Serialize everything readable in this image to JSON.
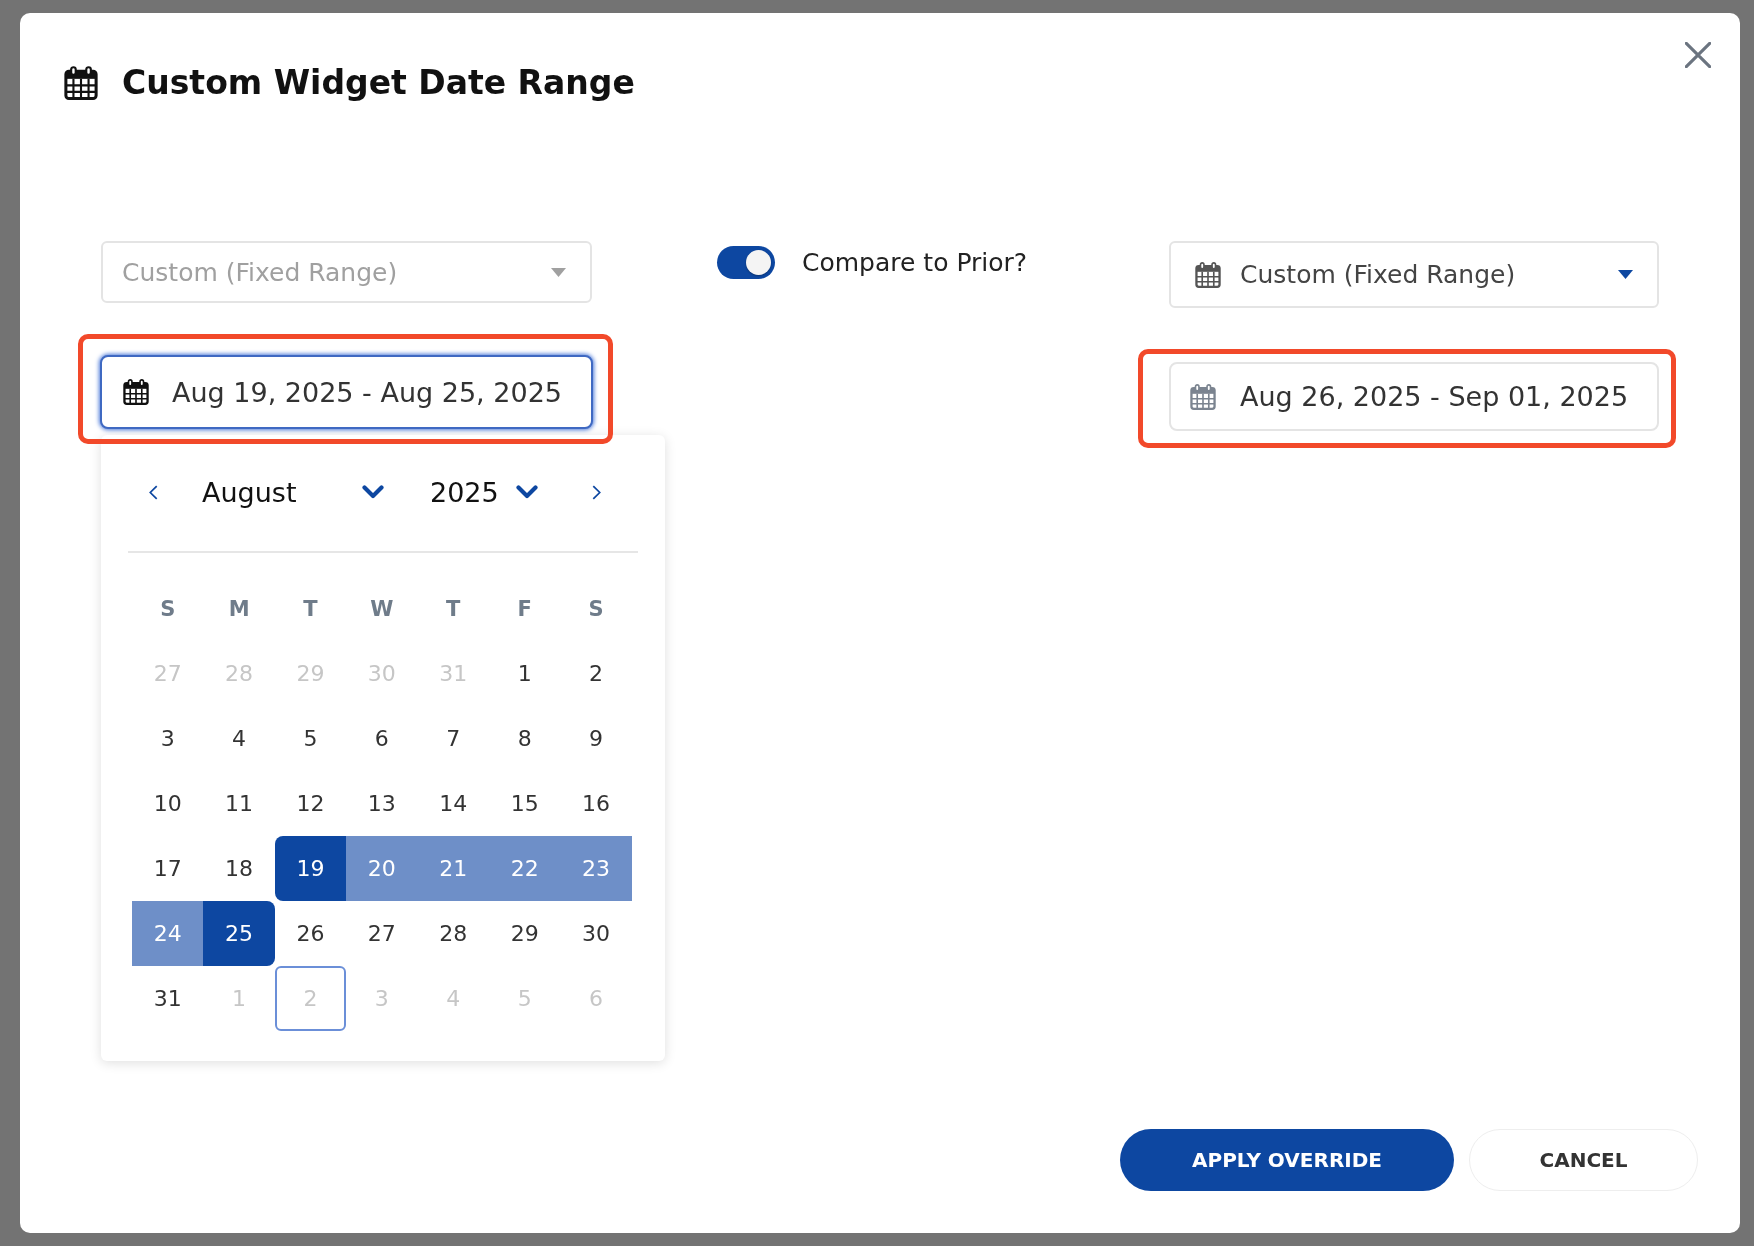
{
  "dialog": {
    "title": "Custom Widget Date Range"
  },
  "preset_select": {
    "value": "Custom (Fixed Range)",
    "disabled": true,
    "has_icon": false
  },
  "date_range_field": {
    "value": "Aug 19, 2025 - Aug 25, 2025",
    "focused": true,
    "highlighted": true
  },
  "compare_toggle": {
    "label": "Compare to Prior?",
    "on": true
  },
  "compare_preset_select": {
    "value": "Custom (Fixed Range)",
    "disabled": false,
    "has_icon": true
  },
  "compare_range_field": {
    "value": "Aug 26, 2025 - Sep 01, 2025",
    "focused": false,
    "highlighted": true
  },
  "calendar": {
    "month": "August",
    "year": "2025",
    "weekdays": [
      "S",
      "M",
      "T",
      "W",
      "T",
      "F",
      "S"
    ],
    "weeks": [
      [
        {
          "label": "27",
          "outside": true,
          "selected": false,
          "in_range": false,
          "today": false
        },
        {
          "label": "28",
          "outside": true,
          "selected": false,
          "in_range": false,
          "today": false
        },
        {
          "label": "29",
          "outside": true,
          "selected": false,
          "in_range": false,
          "today": false
        },
        {
          "label": "30",
          "outside": true,
          "selected": false,
          "in_range": false,
          "today": false
        },
        {
          "label": "31",
          "outside": true,
          "selected": false,
          "in_range": false,
          "today": false
        },
        {
          "label": "1",
          "outside": false,
          "selected": false,
          "in_range": false,
          "today": false
        },
        {
          "label": "2",
          "outside": false,
          "selected": false,
          "in_range": false,
          "today": false
        }
      ],
      [
        {
          "label": "3",
          "outside": false,
          "selected": false,
          "in_range": false,
          "today": false
        },
        {
          "label": "4",
          "outside": false,
          "selected": false,
          "in_range": false,
          "today": false
        },
        {
          "label": "5",
          "outside": false,
          "selected": false,
          "in_range": false,
          "today": false
        },
        {
          "label": "6",
          "outside": false,
          "selected": false,
          "in_range": false,
          "today": false
        },
        {
          "label": "7",
          "outside": false,
          "selected": false,
          "in_range": false,
          "today": false
        },
        {
          "label": "8",
          "outside": false,
          "selected": false,
          "in_range": false,
          "today": false
        },
        {
          "label": "9",
          "outside": false,
          "selected": false,
          "in_range": false,
          "today": false
        }
      ],
      [
        {
          "label": "10",
          "outside": false,
          "selected": false,
          "in_range": false,
          "today": false
        },
        {
          "label": "11",
          "outside": false,
          "selected": false,
          "in_range": false,
          "today": false
        },
        {
          "label": "12",
          "outside": false,
          "selected": false,
          "in_range": false,
          "today": false
        },
        {
          "label": "13",
          "outside": false,
          "selected": false,
          "in_range": false,
          "today": false
        },
        {
          "label": "14",
          "outside": false,
          "selected": false,
          "in_range": false,
          "today": false
        },
        {
          "label": "15",
          "outside": false,
          "selected": false,
          "in_range": false,
          "today": false
        },
        {
          "label": "16",
          "outside": false,
          "selected": false,
          "in_range": false,
          "today": false
        }
      ],
      [
        {
          "label": "17",
          "outside": false,
          "selected": false,
          "in_range": false,
          "today": false
        },
        {
          "label": "18",
          "outside": false,
          "selected": false,
          "in_range": false,
          "today": false
        },
        {
          "label": "19",
          "outside": false,
          "selected": true,
          "in_range": false,
          "today": false
        },
        {
          "label": "20",
          "outside": false,
          "selected": false,
          "in_range": true,
          "today": false
        },
        {
          "label": "21",
          "outside": false,
          "selected": false,
          "in_range": true,
          "today": false
        },
        {
          "label": "22",
          "outside": false,
          "selected": false,
          "in_range": true,
          "today": false
        },
        {
          "label": "23",
          "outside": false,
          "selected": false,
          "in_range": true,
          "today": false
        }
      ],
      [
        {
          "label": "24",
          "outside": false,
          "selected": false,
          "in_range": true,
          "today": false
        },
        {
          "label": "25",
          "outside": false,
          "selected": true,
          "in_range": false,
          "today": false
        },
        {
          "label": "26",
          "outside": false,
          "selected": false,
          "in_range": false,
          "today": false
        },
        {
          "label": "27",
          "outside": false,
          "selected": false,
          "in_range": false,
          "today": false
        },
        {
          "label": "28",
          "outside": false,
          "selected": false,
          "in_range": false,
          "today": false
        },
        {
          "label": "29",
          "outside": false,
          "selected": false,
          "in_range": false,
          "today": false
        },
        {
          "label": "30",
          "outside": false,
          "selected": false,
          "in_range": false,
          "today": false
        }
      ],
      [
        {
          "label": "31",
          "outside": false,
          "selected": false,
          "in_range": false,
          "today": false
        },
        {
          "label": "1",
          "outside": true,
          "selected": false,
          "in_range": false,
          "today": false
        },
        {
          "label": "2",
          "outside": true,
          "selected": false,
          "in_range": false,
          "today": true
        },
        {
          "label": "3",
          "outside": true,
          "selected": false,
          "in_range": false,
          "today": false
        },
        {
          "label": "4",
          "outside": true,
          "selected": false,
          "in_range": false,
          "today": false
        },
        {
          "label": "5",
          "outside": true,
          "selected": false,
          "in_range": false,
          "today": false
        },
        {
          "label": "6",
          "outside": true,
          "selected": false,
          "in_range": false,
          "today": false
        }
      ]
    ]
  },
  "buttons": [
    {
      "label": "APPLY OVERRIDE",
      "kind": "primary"
    },
    {
      "label": "CANCEL",
      "kind": "secondary"
    }
  ]
}
